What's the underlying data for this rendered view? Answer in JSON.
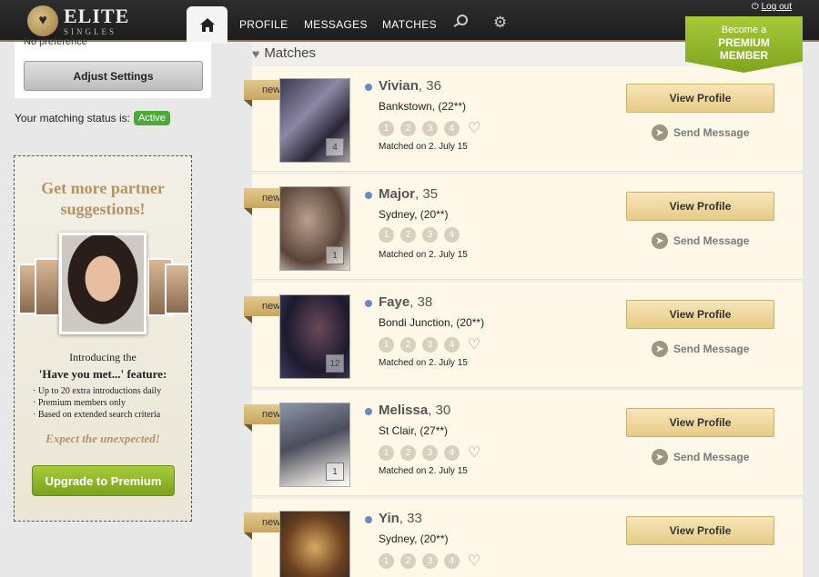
{
  "header": {
    "logo": {
      "name": "ELITE",
      "tagline": "SINGLES"
    },
    "nav": [
      {
        "label": "PROFILE"
      },
      {
        "label": "MESSAGES"
      },
      {
        "label": "MATCHES"
      }
    ],
    "logout_label": "Log out",
    "premium_badge": {
      "line1": "Become a",
      "line2": "PREMIUM",
      "line3": "MEMBER"
    }
  },
  "sidebar": {
    "cut_text": "No preference",
    "adjust_settings_label": "Adjust Settings",
    "matching_status_label": "Your matching status is:",
    "matching_status_value": "Active",
    "promo": {
      "title_line1": "Get more partner",
      "title_line2": "suggestions!",
      "intro": "Introducing the",
      "feature": "'Have you met...' feature:",
      "bullets": [
        "· Up to 20 extra introductions daily",
        "· Premium members only",
        "· Based on extended search criteria"
      ],
      "expect": "Expect the unexpected!",
      "upgrade_label": "Upgrade to Premium"
    }
  },
  "matches": {
    "title": "Matches",
    "new_label": "new",
    "view_profile_label": "View Profile",
    "send_message_label": "Send Message",
    "items": [
      {
        "name": "Vivian",
        "age": ", 36",
        "location": "Bankstown, (22**)",
        "matched": "Matched on 2. July 15",
        "photos": "4"
      },
      {
        "name": "Major",
        "age": ", 35",
        "location": "Sydney, (20**)",
        "matched": "Matched on 2. July 15",
        "photos": "1"
      },
      {
        "name": "Faye",
        "age": ", 38",
        "location": "Bondi Junction, (20**)",
        "matched": "Matched on 2. July 15",
        "photos": "12"
      },
      {
        "name": "Melissa",
        "age": ", 30",
        "location": "St Clair, (27**)",
        "matched": "Matched on 2. July 15",
        "photos": "1"
      },
      {
        "name": "Yin",
        "age": ", 33",
        "location": "Sydney, (20**)",
        "matched": "",
        "photos": ""
      }
    ]
  },
  "colors": {
    "accent_gold": "#c9a55f",
    "premium_green": "#8bb32a",
    "status_green": "#4caa39",
    "online_dot": "#6c8bbd"
  }
}
